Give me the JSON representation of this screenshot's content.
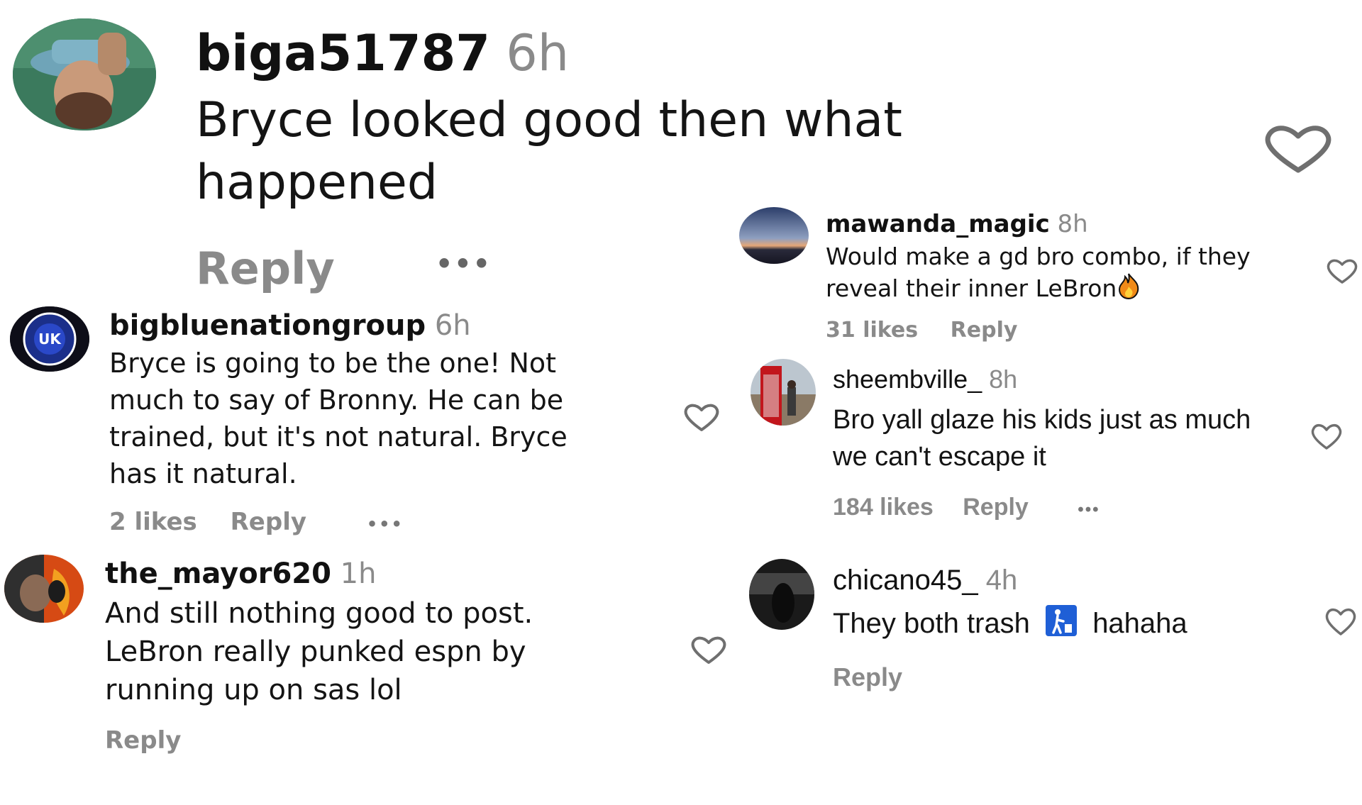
{
  "comments": [
    {
      "username": "biga51787",
      "time": "6h",
      "text_lines": [
        "Bryce looked good then what",
        "happened"
      ],
      "reply": "Reply",
      "more": "•••"
    },
    {
      "username": "bigbluenationgroup",
      "time": "6h",
      "text_lines": [
        "Bryce is going to be the one! Not",
        "much to say of Bronny. He can be",
        "trained, but it's not natural. Bryce",
        "has it natural."
      ],
      "likes": "2 likes",
      "reply": "Reply",
      "more": "•••"
    },
    {
      "username": "the_mayor620",
      "time": "1h",
      "text_lines": [
        "And still nothing good to post.",
        "LeBron really punked espn by",
        "running up on sas lol"
      ],
      "reply": "Reply"
    },
    {
      "username": "mawanda_magic",
      "time": "8h",
      "text_lines": [
        "Would make a gd bro combo, if they",
        "reveal their inner LeBron"
      ],
      "emoji": "fire-emoji",
      "likes": "31 likes",
      "reply": "Reply"
    },
    {
      "username": "sheembville_",
      "time": "8h",
      "text_lines": [
        "Bro yall glaze his kids just as much",
        "we can't escape it"
      ],
      "likes": "184 likes",
      "reply": "Reply",
      "more": "•••"
    },
    {
      "username": "chicano45_",
      "time": "4h",
      "text_before": "They both trash",
      "text_after": "hahaha",
      "emoji": "litter-bin-emoji",
      "reply": "Reply"
    }
  ],
  "colors": {
    "text": "#111111",
    "muted": "#8a8a8a",
    "heart_stroke": "#6f6f6f",
    "emoji_blue": "#1f5fd6"
  }
}
